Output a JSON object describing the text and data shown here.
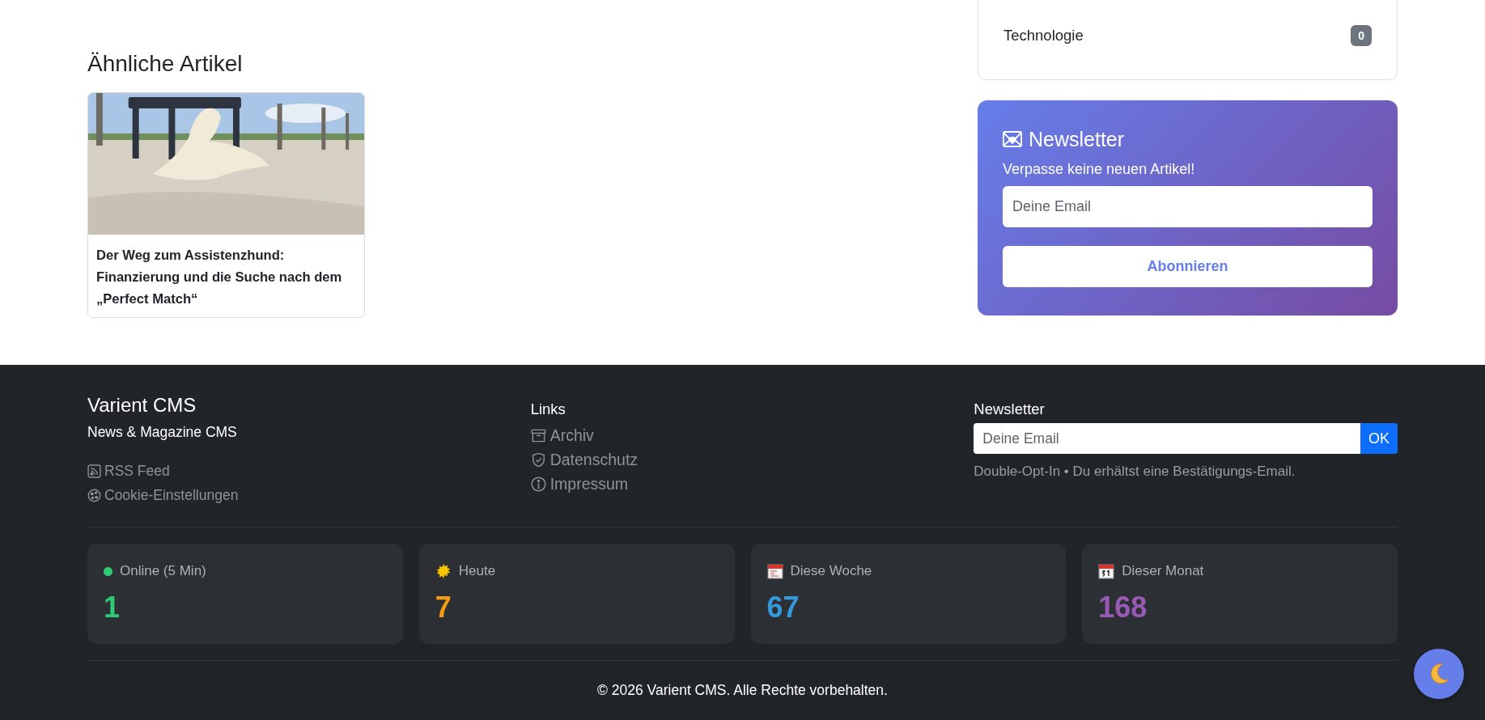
{
  "sidebar": {
    "categories": [
      {
        "name": "Technologie",
        "count": "0"
      }
    ],
    "newsletter": {
      "title": "Newsletter",
      "text": "Verpasse keine neuen Artikel!",
      "placeholder": "Deine Email",
      "button": "Abonnieren"
    }
  },
  "related": {
    "title": "Ähnliche Artikel",
    "articles": [
      {
        "title": "Der Weg zum Assistenzhund: Finanzierung und die Suche nach dem „Perfect Match“"
      }
    ]
  },
  "footer": {
    "brand": "Varient CMS",
    "tagline": "News & Magazine CMS",
    "brand_links": [
      {
        "label": "RSS Feed",
        "kind": "rss"
      },
      {
        "label": "Cookie-Einstellungen",
        "kind": "cookie"
      }
    ],
    "links": {
      "title": "Links",
      "items": [
        {
          "label": "Archiv",
          "kind": "archive"
        },
        {
          "label": "Datenschutz",
          "kind": "shield"
        },
        {
          "label": "Impressum",
          "kind": "info"
        }
      ]
    },
    "newsletter": {
      "title": "Newsletter",
      "placeholder": "Deine Email",
      "button": "OK",
      "note": "Double-Opt-In • Du erhältst eine Bestätigungs-Email."
    },
    "stats": [
      {
        "label": "Online (5 Min)",
        "value": "1",
        "kind": "dot",
        "color": "#2ecc71"
      },
      {
        "label": "Heute",
        "value": "7",
        "kind": "sun",
        "color": "#f39c12"
      },
      {
        "label": "Diese Woche",
        "value": "67",
        "kind": "calendar",
        "color": "#3498db"
      },
      {
        "label": "Dieser Monat",
        "value": "168",
        "kind": "date",
        "color": "#9b59b6"
      }
    ],
    "copyright": "© 2026 Varient CMS. Alle Rechte vorbehalten."
  }
}
